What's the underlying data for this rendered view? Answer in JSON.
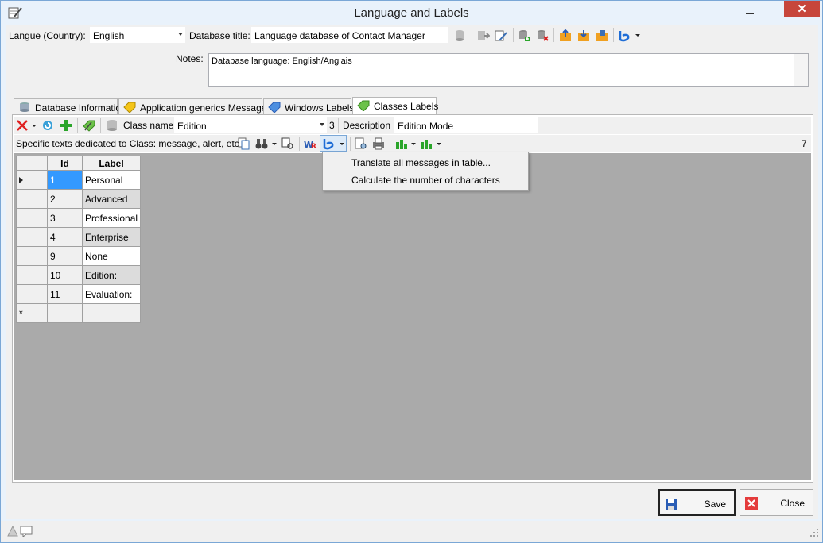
{
  "window": {
    "title": "Language and Labels",
    "close_symbol": "✕"
  },
  "header": {
    "language_label": "Langue (Country):",
    "language_value": "English",
    "db_title_label": "Database title:",
    "db_title_value": "Language database of Contact Manager",
    "notes_label": "Notes:",
    "notes_value": "Database language: English/Anglais"
  },
  "tabs": [
    {
      "label": "Database Information",
      "icon": "database-icon"
    },
    {
      "label": "Application generics Messages",
      "icon": "tag-icon"
    },
    {
      "label": "Windows Labels",
      "icon": "tag-icon"
    },
    {
      "label": "Classes Labels",
      "icon": "tag-icon",
      "active": true
    }
  ],
  "class_bar": {
    "class_name_label": "Class name",
    "class_name_value": "Edition",
    "class_id": "3",
    "description_label": "Description",
    "description_value": "Edition Mode"
  },
  "texts_bar": {
    "caption": "Specific texts dedicated to Class: message, alert, etc.",
    "count": "7"
  },
  "grid": {
    "columns": [
      "Id",
      "Label"
    ],
    "rows": [
      {
        "id": "1",
        "label": "Personal"
      },
      {
        "id": "2",
        "label": "Advanced"
      },
      {
        "id": "3",
        "label": "Professional"
      },
      {
        "id": "4",
        "label": "Enterprise"
      },
      {
        "id": "9",
        "label": "None"
      },
      {
        "id": "10",
        "label": "Edition:"
      },
      {
        "id": "11",
        "label": "Evaluation:"
      }
    ],
    "new_row_marker": "*"
  },
  "context_menu": {
    "items": [
      "Translate all messages in table...",
      "Calculate the number of characters"
    ]
  },
  "footer": {
    "save_label": "Save",
    "close_label": "Close"
  },
  "colors": {
    "selection": "#3399ff",
    "grid_background": "#aaaaaa",
    "close_red": "#c7463b"
  }
}
